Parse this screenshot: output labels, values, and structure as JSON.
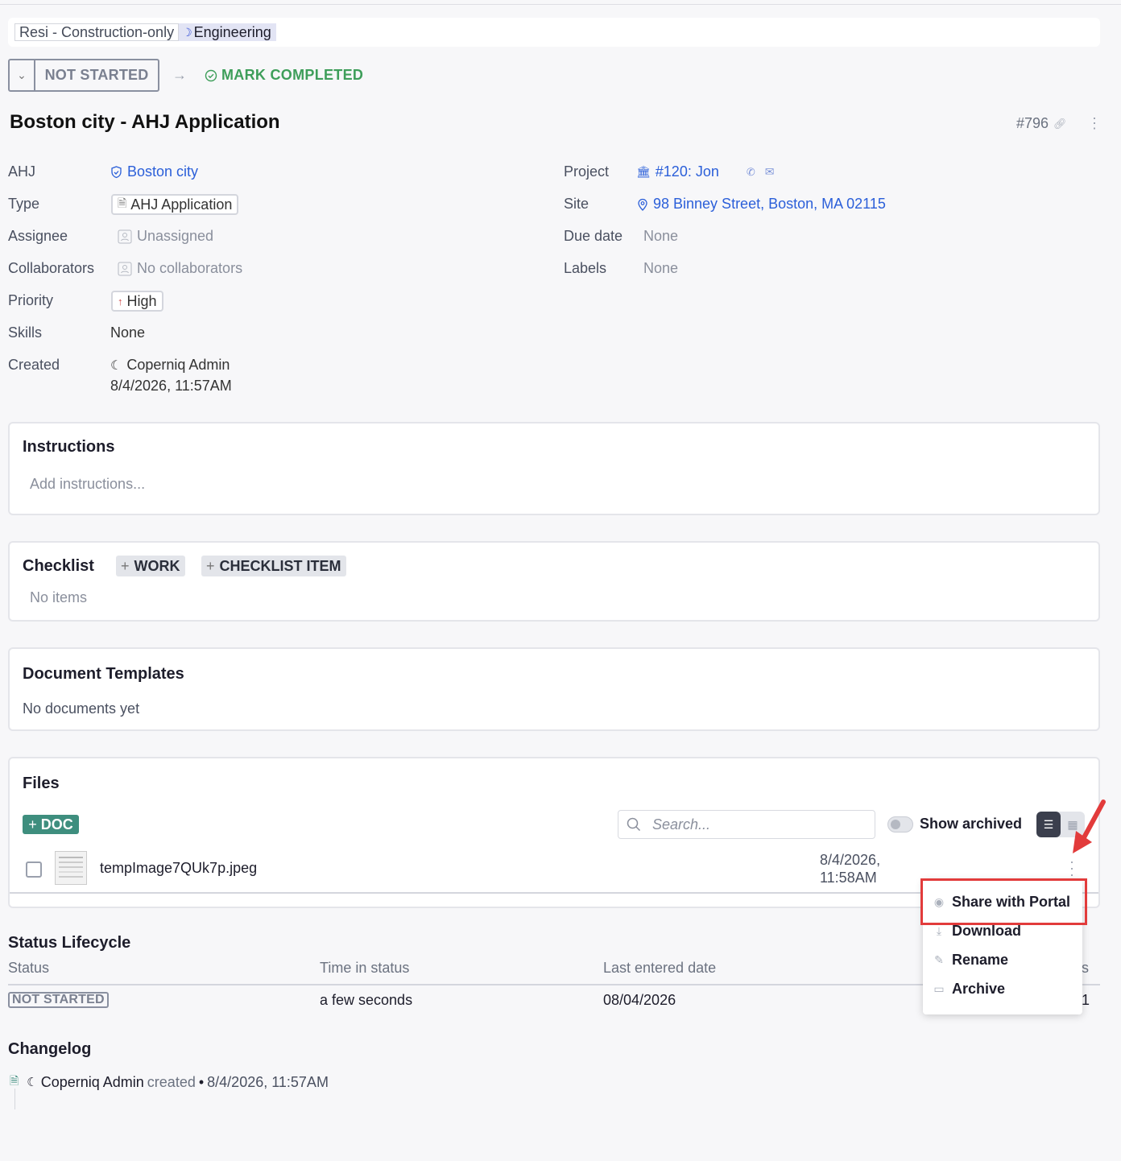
{
  "breadcrumb": {
    "workflow": "Resi - Construction-only",
    "stage": "Engineering"
  },
  "status": {
    "current": "NOT STARTED",
    "action": "MARK COMPLETED"
  },
  "task": {
    "title": "Boston city - AHJ Application",
    "id": "#796"
  },
  "fields": {
    "ahj": {
      "label": "AHJ",
      "value": "Boston city"
    },
    "type": {
      "label": "Type",
      "value": "AHJ Application"
    },
    "assignee": {
      "label": "Assignee",
      "value": "Unassigned"
    },
    "collaborators": {
      "label": "Collaborators",
      "value": "No collaborators"
    },
    "priority": {
      "label": "Priority",
      "value": "High"
    },
    "skills": {
      "label": "Skills",
      "value": "None"
    },
    "created": {
      "label": "Created",
      "by": "Coperniq Admin",
      "date": "8/4/2026, 11:57AM"
    },
    "project": {
      "label": "Project",
      "value": "#120: Jon"
    },
    "site": {
      "label": "Site",
      "value": "98 Binney Street, Boston, MA 02115"
    },
    "due_date": {
      "label": "Due date",
      "value": "None"
    },
    "labels": {
      "label": "Labels",
      "value": "None"
    }
  },
  "instructions": {
    "title": "Instructions",
    "placeholder": "Add instructions..."
  },
  "checklist": {
    "title": "Checklist",
    "add_work": "WORK",
    "add_item": "CHECKLIST ITEM",
    "empty": "No items"
  },
  "document_templates": {
    "title": "Document Templates",
    "empty": "No documents yet"
  },
  "files": {
    "title": "Files",
    "add_doc": "DOC",
    "search_placeholder": "Search...",
    "show_archived": "Show archived",
    "rows": [
      {
        "name": "tempImage7QUk7p.jpeg",
        "date": "8/4/2026,",
        "time": "11:58AM"
      }
    ]
  },
  "menu": {
    "items": [
      "Share with Portal",
      "Download",
      "Rename",
      "Archive"
    ]
  },
  "status_lifecycle": {
    "title": "Status Lifecycle",
    "headers": [
      "Status",
      "Time in status",
      "Last entered date",
      "s"
    ],
    "row": {
      "status": "NOT STARTED",
      "time": "a few seconds",
      "date": "08/04/2026",
      "last": "1"
    }
  },
  "changelog": {
    "title": "Changelog",
    "author": "Coperniq Admin",
    "action": "created",
    "sep": "•",
    "date": "8/4/2026, 11:57AM"
  },
  "colors": {
    "link": "#2b5fd9",
    "success": "#3e9e5a",
    "doc_button": "#3e8e7e",
    "highlight": "#e23b3b"
  }
}
